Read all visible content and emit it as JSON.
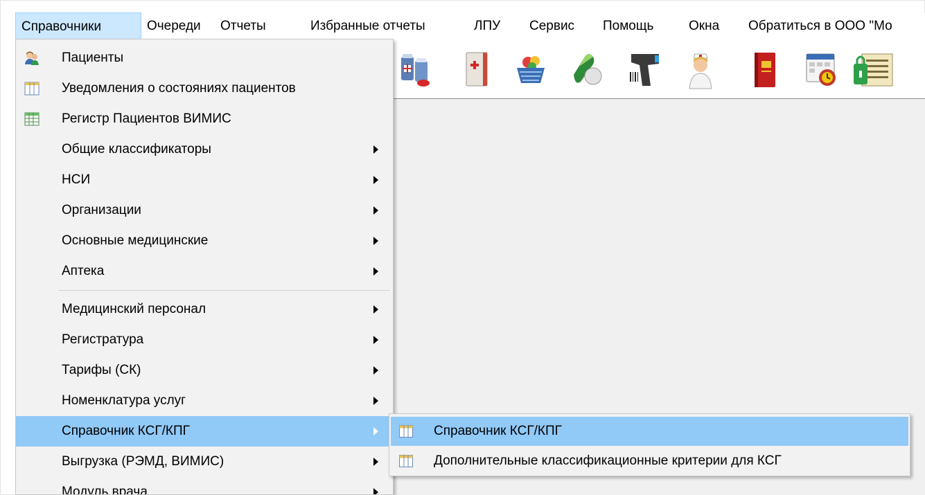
{
  "menubar": {
    "items": [
      {
        "label": "Справочники"
      },
      {
        "label": "Очереди"
      },
      {
        "label": "Отчеты"
      },
      {
        "label": "Избранные отчеты"
      },
      {
        "label": "ЛПУ"
      },
      {
        "label": "Сервис"
      },
      {
        "label": "Помощь"
      },
      {
        "label": "Окна"
      },
      {
        "label": "Обратиться в ООО \"Мо"
      }
    ]
  },
  "toolbar": {
    "icons": [
      "medicines-icon",
      "medical-book-icon",
      "basket-icon",
      "pills-icon",
      "barcode-scanner-icon",
      "nurse-icon",
      "red-book-icon",
      "schedule-icon",
      "security-document-icon"
    ]
  },
  "menu": {
    "items": [
      {
        "label": "Пациенты",
        "icon": "patients-icon"
      },
      {
        "label": "Уведомления о состояниях пациентов",
        "icon": "table-icon"
      },
      {
        "label": "Регистр Пациентов ВИМИС",
        "icon": "spreadsheet-icon"
      },
      {
        "label": "Общие классификаторы",
        "submenu": true
      },
      {
        "label": "НСИ",
        "submenu": true
      },
      {
        "label": "Организации",
        "submenu": true
      },
      {
        "label": "Основные медицинские",
        "submenu": true
      },
      {
        "label": "Аптека",
        "submenu": true
      },
      {
        "label": "Медицинский персонал",
        "submenu": true
      },
      {
        "label": "Регистратура",
        "submenu": true
      },
      {
        "label": "Тарифы (СК)",
        "submenu": true
      },
      {
        "label": "Номенклатура услуг",
        "submenu": true
      },
      {
        "label": "Справочник КСГ/КПГ",
        "submenu": true,
        "highlighted": true
      },
      {
        "label": "Выгрузка (РЭМД, ВИМИС)",
        "submenu": true
      },
      {
        "label": "Модуль врача",
        "submenu": true
      }
    ]
  },
  "submenu": {
    "items": [
      {
        "label": "Справочник КСГ/КПГ",
        "icon": "table-icon",
        "highlighted": true
      },
      {
        "label": "Дополнительные классификационные критерии для КСГ",
        "icon": "table-icon"
      }
    ]
  },
  "colors": {
    "highlight": "#91c9f7",
    "menubar_active": "#cce8ff",
    "menu_background": "#f2f2f2"
  }
}
